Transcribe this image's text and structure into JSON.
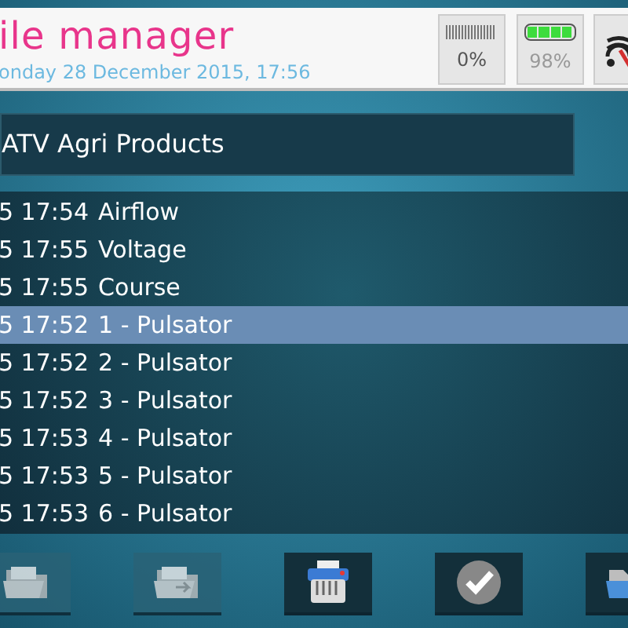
{
  "header": {
    "title": "ile manager",
    "datetime": "onday 28 December 2015, 17:56"
  },
  "status": {
    "signal": {
      "reading": "0%"
    },
    "battery": {
      "level": 0.98,
      "reading": "98%"
    },
    "wifi": {
      "connected": false
    }
  },
  "folder_title": "ATV Agri Products",
  "files": [
    {
      "time": "5 17:54",
      "name": "Airflow",
      "selected": false
    },
    {
      "time": "5 17:55",
      "name": "Voltage",
      "selected": false
    },
    {
      "time": "5 17:55",
      "name": "Course",
      "selected": false
    },
    {
      "time": "5 17:52",
      "name": "1 - Pulsator",
      "selected": true
    },
    {
      "time": "5 17:52",
      "name": "2 - Pulsator",
      "selected": false
    },
    {
      "time": "5 17:52",
      "name": "3 - Pulsator",
      "selected": false
    },
    {
      "time": "5 17:53",
      "name": "4 - Pulsator",
      "selected": false
    },
    {
      "time": "5 17:53",
      "name": "5 - Pulsator",
      "selected": false
    },
    {
      "time": "5 17:53",
      "name": "6 - Pulsator",
      "selected": false
    }
  ],
  "toolbar": [
    {
      "kind": "open",
      "disabled": true
    },
    {
      "kind": "export",
      "disabled": true
    },
    {
      "kind": "shred",
      "disabled": false
    },
    {
      "kind": "confirm",
      "disabled": false
    },
    {
      "kind": "folder",
      "disabled": false
    }
  ]
}
